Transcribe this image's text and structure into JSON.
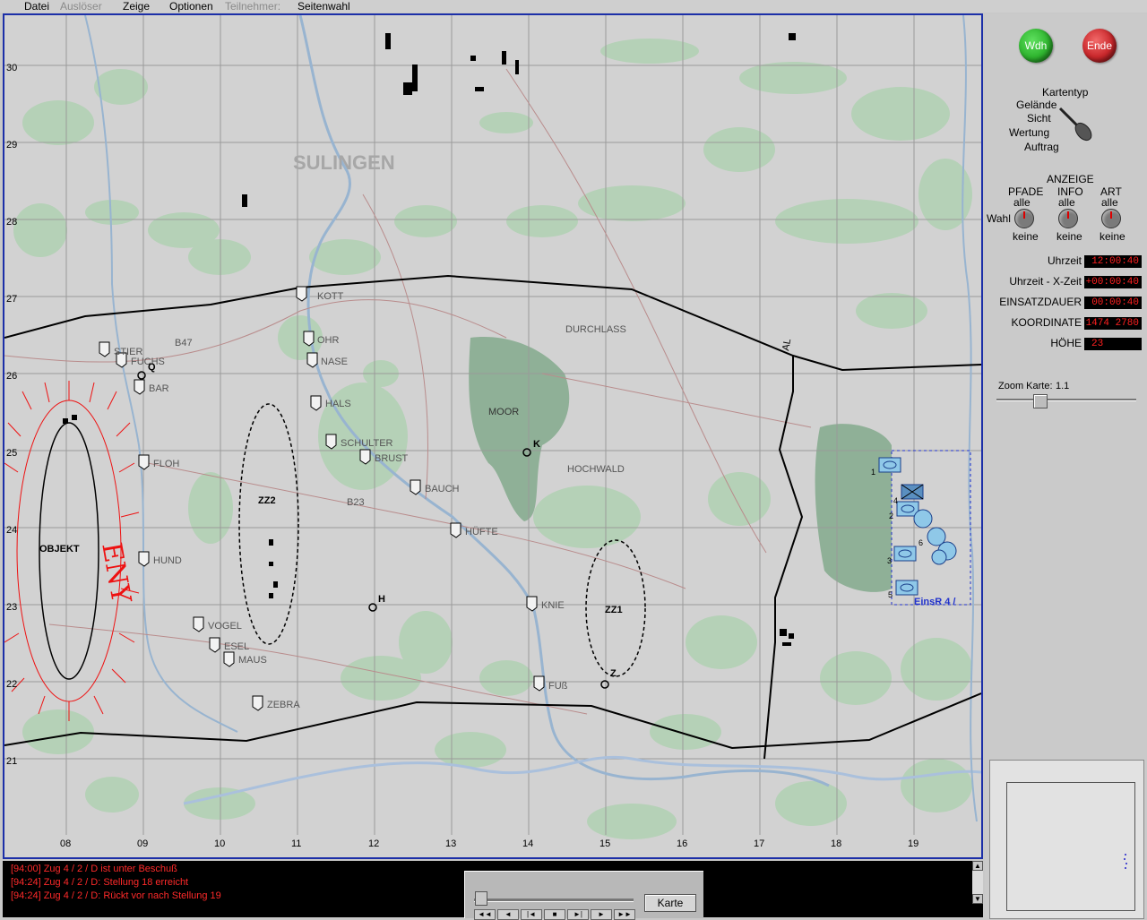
{
  "menu": {
    "items": [
      {
        "label": "Datei",
        "enabled": true
      },
      {
        "label": "Auslöser",
        "enabled": false
      },
      {
        "label": "Zeige",
        "enabled": true
      },
      {
        "label": "Optionen",
        "enabled": true
      },
      {
        "label": "Teilnehmer:",
        "enabled": false
      },
      {
        "label": "Seitenwahl",
        "enabled": true
      }
    ]
  },
  "map": {
    "grid_x_labels": [
      "08",
      "09",
      "10",
      "11",
      "12",
      "13",
      "14",
      "15",
      "16",
      "17",
      "18",
      "19"
    ],
    "grid_y_labels": [
      "30",
      "29",
      "28",
      "27",
      "26",
      "25",
      "24",
      "23",
      "22",
      "21"
    ],
    "town": "SULINGEN",
    "area_labels": [
      "DURCHLASS",
      "MOOR",
      "HOCHWALD",
      "B47",
      "B23",
      "AL"
    ],
    "positions": [
      "KOTT",
      "OHR",
      "NASE",
      "HALS",
      "SCHULTER",
      "BRUST",
      "BAUCH",
      "HÜFTE",
      "KNIE",
      "FUß",
      "STIER",
      "FUCHS",
      "BAR",
      "FLOH",
      "HUND",
      "VOGEL",
      "ESEL",
      "MAUS",
      "ZEBRA"
    ],
    "points": [
      "K",
      "H",
      "Z",
      "Q"
    ],
    "zones": [
      "ZZ2",
      "ZZ1"
    ],
    "objective": "OBJEKT",
    "enemy": "ENY",
    "unit_label": "EinsR 4 /",
    "unit_numbers": [
      "1",
      "2",
      "3",
      "4",
      "5",
      "6"
    ]
  },
  "buttons": {
    "repeat": "Wdh",
    "end": "Ende"
  },
  "kartentyp": {
    "title": "Kartentyp",
    "options": [
      "Gelände",
      "Sicht",
      "Wertung",
      "Auftrag"
    ],
    "selected": "Gelände"
  },
  "anzeige": {
    "title": "ANZEIGE",
    "wahl_label": "Wahl",
    "knobs": [
      {
        "label": "PFADE",
        "top": "alle",
        "bottom": "keine"
      },
      {
        "label": "INFO",
        "top": "alle",
        "bottom": "keine"
      },
      {
        "label": "ART",
        "top": "alle",
        "bottom": "keine"
      }
    ]
  },
  "status": {
    "fields": [
      {
        "label": "Uhrzeit",
        "value": "12:00:40"
      },
      {
        "label": "Uhrzeit - X-Zeit",
        "value": "+00:00:40"
      },
      {
        "label": "EINSATZDAUER",
        "value": "00:00:40"
      },
      {
        "label": "KOORDINATE",
        "value": "1474 2780"
      },
      {
        "label": "HÖHE",
        "value": "23"
      }
    ]
  },
  "zoom": {
    "label": "Zoom Karte:",
    "value": "1.1"
  },
  "log": {
    "lines": [
      "[94:00] Zug 4 / 2 / D ist unter Beschuß",
      "[94:24] Zug 4 / 2 / D: Stellung 18 erreicht",
      "[94:24] Zug 4 / 2 / D: Rückt vor nach Stellung 19"
    ]
  },
  "replay": {
    "button": "Karte",
    "controls": [
      "◄◄",
      "◄",
      "|◄",
      "■",
      "►|",
      "►",
      "►►"
    ]
  },
  "colors": {
    "frame": "#1c2fa8",
    "button_green": "#2fb52f",
    "button_red": "#c9272b",
    "lcd_text": "#ff2020",
    "log_text": "#ff2a2a",
    "forest": "#a9c7ad",
    "dark_forest": "#8fb097",
    "unit": "#8fc8e8",
    "enemy": "#ee1111"
  }
}
